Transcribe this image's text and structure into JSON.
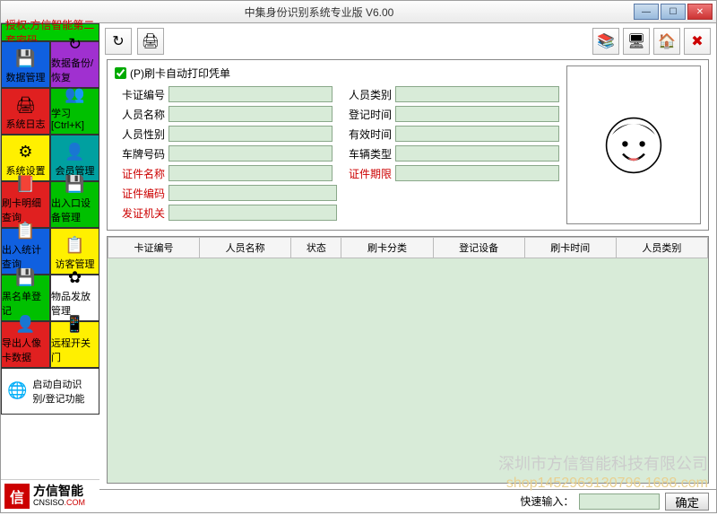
{
  "window": {
    "title": "中集身份识别系统专业版 V6.00"
  },
  "auth": "授权:方信智能第二套密码",
  "tiles": [
    {
      "label": "数据管理",
      "bg": "#1060e0",
      "icon": "💾"
    },
    {
      "label": "数据备份/恢复",
      "bg": "#a030d0",
      "icon": "↻"
    },
    {
      "label": "系统日志",
      "bg": "#e02020",
      "icon": "🖨"
    },
    {
      "label": "学习[Ctrl+K]",
      "bg": "#00c000",
      "icon": "👥"
    },
    {
      "label": "系统设置",
      "bg": "#fff000",
      "icon": "⚙"
    },
    {
      "label": "会员管理",
      "bg": "#00a0a0",
      "icon": "👤"
    },
    {
      "label": "刷卡明细查询",
      "bg": "#e02020",
      "icon": "📕"
    },
    {
      "label": "出入口设备管理",
      "bg": "#00c000",
      "icon": "💾"
    },
    {
      "label": "出入统计查询",
      "bg": "#1060e0",
      "icon": "📋"
    },
    {
      "label": "访客管理",
      "bg": "#fff000",
      "icon": "📋"
    },
    {
      "label": "黑名单登记",
      "bg": "#00c000",
      "icon": "💾"
    },
    {
      "label": "物品发放管理",
      "bg": "#ffffff",
      "icon": "✿"
    },
    {
      "label": "导出人像卡数据",
      "bg": "#e02020",
      "icon": "👤"
    },
    {
      "label": "远程开关门",
      "bg": "#fff000",
      "icon": "📱"
    }
  ],
  "wideTile": {
    "label": "启动自动识别/登记功能",
    "bg": "#ffffff",
    "icon": "🌐"
  },
  "form": {
    "checkbox": "(P)刷卡自动打印凭单",
    "rows": [
      [
        {
          "l": "卡证编号"
        },
        {
          "l": "人员类别"
        }
      ],
      [
        {
          "l": "人员名称"
        },
        {
          "l": "登记时间"
        }
      ],
      [
        {
          "l": "人员性别"
        },
        {
          "l": "有效时间"
        }
      ],
      [
        {
          "l": "车牌号码"
        },
        {
          "l": "车辆类型"
        }
      ],
      [
        {
          "l": "证件名称",
          "red": true
        },
        {
          "l": "证件期限",
          "red": true
        }
      ],
      [
        {
          "l": "证件编码",
          "red": true
        }
      ],
      [
        {
          "l": "发证机关",
          "red": true
        }
      ]
    ]
  },
  "table": {
    "headers": [
      "卡证编号",
      "人员名称",
      "状态",
      "刷卡分类",
      "登记设备",
      "刷卡时间",
      "人员类别"
    ]
  },
  "status": {
    "label": "快速输入：",
    "btn": "确定"
  },
  "logo": {
    "sq": "信",
    "cn": "方信智能",
    "en1": "CNSISO",
    "en2": ".COM"
  },
  "watermark": {
    "l1": "深圳市方信智能科技有限公司",
    "l2": "shop1452963130796.1688.com"
  }
}
